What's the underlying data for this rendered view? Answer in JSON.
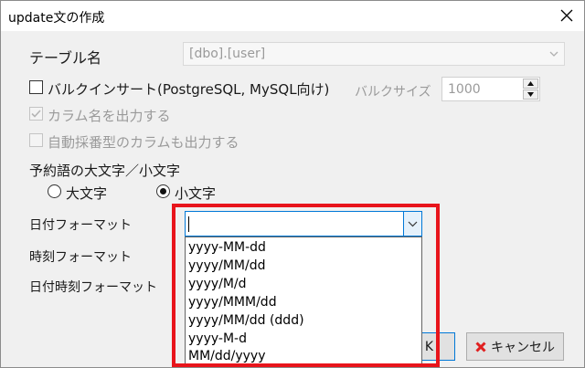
{
  "window": {
    "title": "update文の作成"
  },
  "form": {
    "table_label": "テーブル名",
    "table_value": "[dbo].[user]",
    "bulk_insert_label": "バルクインサート(PostgreSQL, MySQL向け)",
    "bulk_size_label": "バルクサイズ",
    "bulk_size_value": "1000",
    "output_column_names_label": "カラム名を出力する",
    "output_autoincrement_label": "自動採番型のカラムも出力する",
    "reserved_case_label": "予約語の大文字／小文字",
    "upper_label": "大文字",
    "lower_label": "小文字",
    "date_format_label": "日付フォーマット",
    "time_format_label": "時刻フォーマット",
    "datetime_format_label": "日付時刻フォーマット",
    "date_format_value": ""
  },
  "dropdown": {
    "options": [
      "yyyy-MM-dd",
      "yyyy/MM/dd",
      "yyyy/M/d",
      "yyyy/MMM/dd",
      "yyyy/MM/dd (ddd)",
      "yyyy-M-d",
      "MM/dd/yyyy"
    ]
  },
  "buttons": {
    "ok_label": "K",
    "cancel_label": "キャンセル"
  },
  "colors": {
    "highlight": "#e8141b",
    "focus_border": "#0078d7",
    "cancel_icon": "#e01f1f"
  }
}
